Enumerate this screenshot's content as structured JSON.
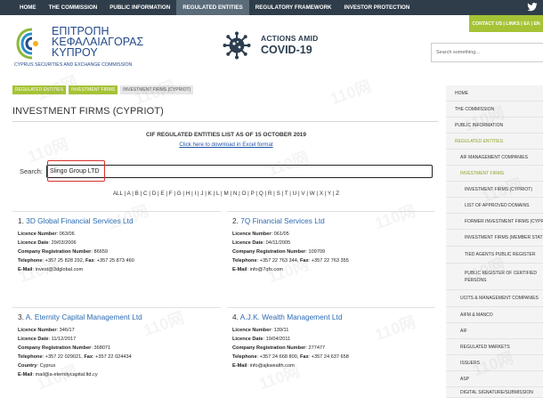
{
  "top_nav": {
    "items": [
      "HOME",
      "THE COMMISSION",
      "PUBLIC INFORMATION",
      "REGULATED ENTITIES",
      "REGULATORY FRAMEWORK",
      "INVESTOR PROTECTION"
    ],
    "active_index": 3
  },
  "contact_bar": {
    "text": "CONTACT US | LINKS | EΛ | EN"
  },
  "logo": {
    "greek_line1": "ΕΠΙΤΡΟΠΗ",
    "greek_line2": "ΚΕΦΑΛΑΙΑΓΟΡΑΣ",
    "greek_line3": "ΚΥΠΡΟΥ",
    "english": "CYPRUS SECURITIES AND EXCHANGE COMMISSION"
  },
  "covid": {
    "line1": "ACTIONS AMID",
    "line2": "COVID-19"
  },
  "search_top": {
    "placeholder": "Search something..."
  },
  "breadcrumbs": [
    "REGULATED ENTITIES",
    "INVESTMENT FIRMS",
    "INVESTMENT FIRMS (CYPRIOT)"
  ],
  "page_title": "INVESTMENT FIRMS (CYPRIOT)",
  "list_header": {
    "heading": "CIF REGULATED ENTITIES LIST AS OF 15 OCTOBER 2019",
    "download_link": "Click here to download in Excel format"
  },
  "search": {
    "label": "Search:",
    "value": "Slingo Group LTD"
  },
  "alphabet": [
    "ALL",
    "A",
    "B",
    "C",
    "D",
    "E",
    "F",
    "G",
    "H",
    "I",
    "J",
    "K",
    "L",
    "M",
    "N",
    "O",
    "P",
    "Q",
    "R",
    "S",
    "T",
    "U",
    "V",
    "W",
    "X",
    "Y",
    "Z"
  ],
  "labels": {
    "licence_number": "Licence Number",
    "licence_date": "Licence Date",
    "company_reg": "Company Registration Number",
    "telephone": "Telephone",
    "fax": "Fax",
    "country": "Country",
    "email": "E-Mail"
  },
  "firms": [
    {
      "index": "1.",
      "name": "3D Global Financial Services Ltd",
      "licence_number": "063/06",
      "licence_date": "29/03/2006",
      "company_reg": "86659",
      "telephone": "+357 25 828 292",
      "fax": "+357 25 873 460",
      "email": "invest@3dglobal.com"
    },
    {
      "index": "2.",
      "name": "7Q Financial Services Ltd",
      "licence_number": "061/05",
      "licence_date": "04/11/2005",
      "company_reg": "109709",
      "telephone": "+357 22 763 344",
      "fax": "+357 22 763 355",
      "email": "info@7qfs.com"
    },
    {
      "index": "3.",
      "name": "A. Eternity Capital Management Ltd",
      "licence_number": "346/17",
      "licence_date": "11/12/2017",
      "company_reg": "368071",
      "telephone": "+357 22 029021",
      "fax": "+357 22 024434",
      "country": "Cyprus",
      "email": "mail@a-eternitycapital.ltd.cy"
    },
    {
      "index": "4.",
      "name": "A.J.K. Wealth Management Ltd",
      "licence_number": "139/11",
      "licence_date": "19/04/2011",
      "company_reg": "277477",
      "telephone": "+357 24 668 800",
      "fax": "+357 24 637 658",
      "email": "info@ajkwealth.com"
    }
  ],
  "sidebar": [
    {
      "label": "HOME"
    },
    {
      "label": "THE COMMISSION"
    },
    {
      "label": "PUBLIC INFORMATION"
    },
    {
      "label": "REGULATED ENTITIES"
    },
    {
      "label": "AIF MANAGEMENT COMPANIES"
    },
    {
      "label": "INVESTMENT FIRMS"
    },
    {
      "label": "INVESTMENT FIRMS (CYPRIOT)"
    },
    {
      "label": "LIST OF APPROVED DOMAINS"
    },
    {
      "label": "FORMER INVESTMENT FIRMS (CYPR"
    },
    {
      "label": "INVESTMENT FIRMS (MEMBER STAT"
    },
    {
      "label": "TIED AGENTS PUBLIC REGISTER"
    },
    {
      "label": "PUBLIC REGISTER OF CERTIFIED PERSONS"
    },
    {
      "label": "UCITS & MANAGEMENT COMPANIES"
    },
    {
      "label": "AIFM & MANCO"
    },
    {
      "label": "AIF"
    },
    {
      "label": "REGULATED MARKETS"
    },
    {
      "label": "ISSUERS"
    },
    {
      "label": "ASP"
    },
    {
      "label": "DIGITAL SIGNATURE/SUBMISSION"
    }
  ],
  "watermark": "110网",
  "colors": {
    "nav_bg": "#2f3d4a",
    "accent_green": "#a5c336",
    "link_blue": "#2b6bb3",
    "highlight_red": "#d9302c"
  }
}
